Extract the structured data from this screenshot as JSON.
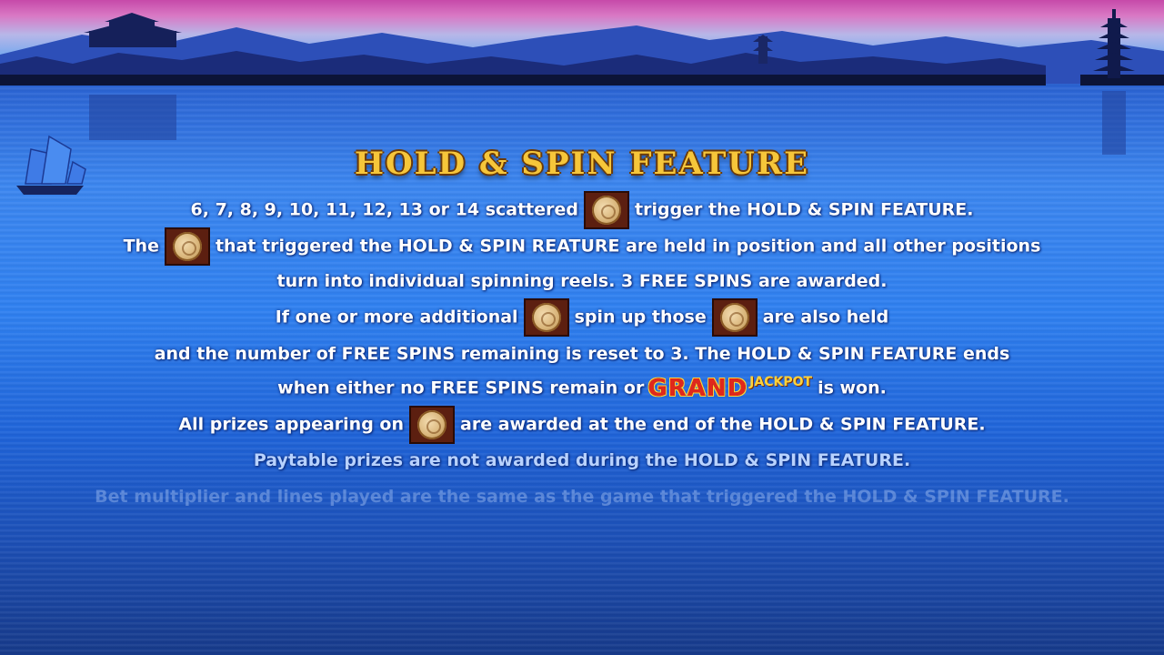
{
  "title": "HOLD & SPIN FEATURE",
  "lines": {
    "l1_a": "6, 7, 8, 9, 10, 11, 12, 13 or 14 scattered",
    "l1_b": "trigger the HOLD & SPIN FEATURE.",
    "l2_a": "The",
    "l2_b": "that triggered the HOLD & SPIN REATURE are held in position and all other positions",
    "l3": "turn into individual spinning reels. 3 FREE SPINS are awarded.",
    "l4_a": "If one or more additional",
    "l4_b": "spin up those",
    "l4_c": "are also held",
    "l5": "and the number of FREE SPINS remaining is reset to 3. The HOLD & SPIN FEATURE ends",
    "l6_a": "when either no FREE SPINS remain or",
    "l6_grand": "GRAND",
    "l6_jackpot": "JACKPOT",
    "l6_b": "is won.",
    "l7_a": "All prizes appearing on",
    "l7_b": "are awarded at the end of the HOLD & SPIN FEATURE.",
    "l8": "Paytable prizes are not awarded during the HOLD & SPIN FEATURE.",
    "l9": "Bet multiplier and lines played are the same as the game that triggered the HOLD & SPIN FEATURE."
  },
  "icons": {
    "coin": "moon-coin-icon",
    "boat": "junk-boat-icon",
    "pagoda": "pagoda-icon",
    "temple": "temple-icon"
  },
  "colors": {
    "title": "#f6c63a",
    "text": "#ffffff",
    "grand": "#e0281c",
    "jackpot": "#ffd23a"
  }
}
